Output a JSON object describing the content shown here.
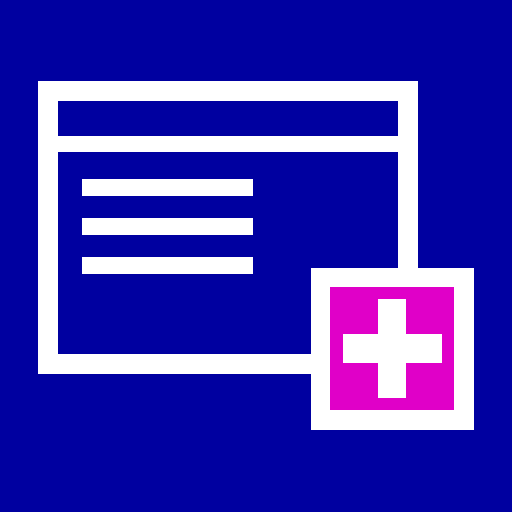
{
  "icon": {
    "name": "add-window-icon",
    "colors": {
      "background": "#0000A0",
      "stroke": "#FFFFFF",
      "badge_fill": "#E000C8",
      "plus": "#FFFFFF"
    },
    "window": {
      "content_lines": 3
    },
    "badge": {
      "symbol": "plus"
    }
  }
}
